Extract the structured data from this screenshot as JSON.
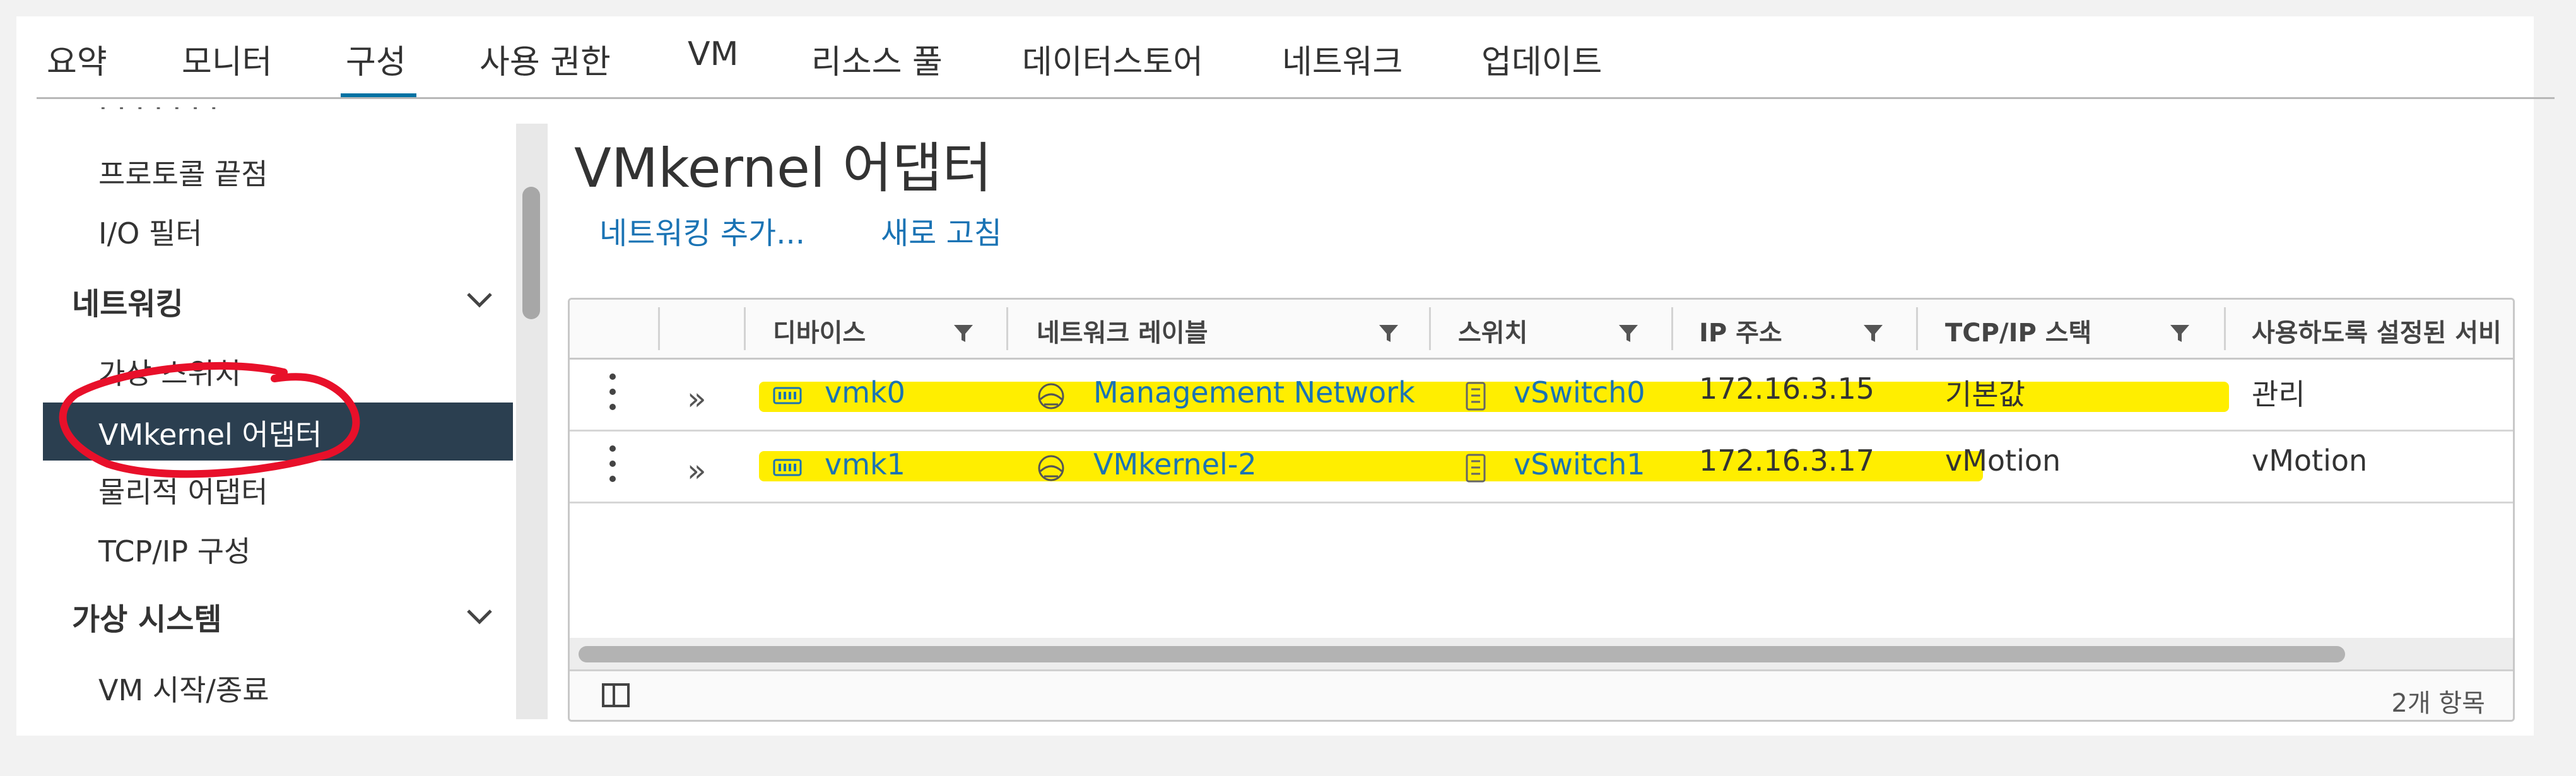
{
  "tabs": [
    {
      "label": "요약"
    },
    {
      "label": "모니터"
    },
    {
      "label": "구성",
      "active": true
    },
    {
      "label": "사용 권한"
    },
    {
      "label": "VM"
    },
    {
      "label": "리소스 풀"
    },
    {
      "label": "데이터스토어"
    },
    {
      "label": "네트워크"
    },
    {
      "label": "업데이트"
    }
  ],
  "sidebar": {
    "items": [
      {
        "label": "프로토콜 끝점"
      },
      {
        "label": "I/O 필터"
      },
      {
        "label": "네트워킹",
        "group": true
      },
      {
        "label": "가상 스위치"
      },
      {
        "label": "VMkernel 어댑터",
        "selected": true
      },
      {
        "label": "물리적 어댑터"
      },
      {
        "label": "TCP/IP 구성"
      },
      {
        "label": "가상 시스템",
        "group": true
      },
      {
        "label": "VM 시작/종료"
      }
    ]
  },
  "main": {
    "title": "VMkernel 어댑터",
    "actions": {
      "add_network": "네트워킹 추가...",
      "refresh": "새로 고침"
    }
  },
  "table": {
    "columns": [
      "디바이스",
      "네트워크 레이블",
      "스위치",
      "IP 주소",
      "TCP/IP 스택",
      "사용하도록 설정된 서비"
    ],
    "rows": [
      {
        "device": "vmk0",
        "network_label": "Management Network",
        "switch": "vSwitch0",
        "ip": "172.16.3.15",
        "stack": "기본값",
        "services": "관리"
      },
      {
        "device": "vmk1",
        "network_label": "VMkernel-2",
        "switch": "vSwitch1",
        "ip": "172.16.3.17",
        "stack": "vMotion",
        "services": "vMotion"
      }
    ],
    "footer_count": "2개 항목"
  },
  "colors": {
    "accent": "#0072a3",
    "link": "#1a73b4",
    "selected_bg": "#2b3f50",
    "highlight": "#ffee00",
    "annotation": "#e8102a"
  },
  "icons": [
    "chevron-down-icon",
    "kebab-menu-icon",
    "expand-icon",
    "nic-icon",
    "network-icon",
    "switch-icon",
    "filter-icon",
    "column-toggle-icon"
  ]
}
